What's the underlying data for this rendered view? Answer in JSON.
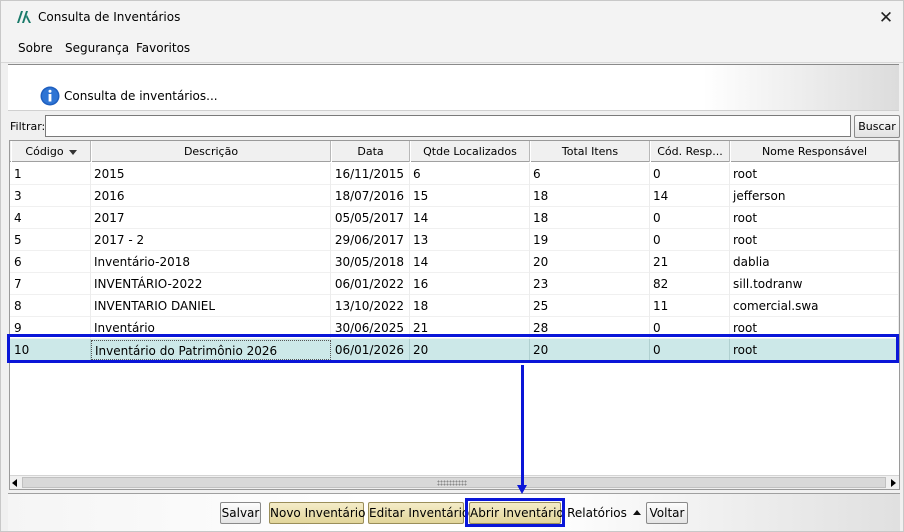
{
  "window": {
    "title": "Consulta de Inventários",
    "close_glyph": "✕"
  },
  "menu": {
    "items": [
      "Sobre",
      "Segurança",
      "Favoritos"
    ]
  },
  "banner": {
    "text": "Consulta de inventários..."
  },
  "filter": {
    "label": "Filtrar:",
    "value": "",
    "search_button": "Buscar"
  },
  "table": {
    "columns": [
      "Código",
      "Descrição",
      "Data",
      "Qtde Localizados",
      "Total Itens",
      "Cód. Resp...",
      "Nome Responsável"
    ],
    "sort_column": "Código",
    "sort_direction": "descending-arrow",
    "rows": [
      [
        "1",
        "2015",
        "16/11/2015",
        "6",
        "6",
        "0",
        "root"
      ],
      [
        "3",
        "2016",
        "18/07/2016",
        "15",
        "18",
        "14",
        "jefferson"
      ],
      [
        "4",
        "2017",
        "05/05/2017",
        "14",
        "18",
        "0",
        "root"
      ],
      [
        "5",
        "2017 - 2",
        "29/06/2017",
        "13",
        "19",
        "0",
        "root"
      ],
      [
        "6",
        "Inventário-2018",
        "30/05/2018",
        "14",
        "20",
        "21",
        "dablia"
      ],
      [
        "7",
        "INVENTÁRIO-2022",
        "06/01/2022",
        "16",
        "23",
        "82",
        "sill.todranw"
      ],
      [
        "8",
        "INVENTARIO DANIEL",
        "13/10/2022",
        "18",
        "25",
        "11",
        "comercial.swa"
      ],
      [
        "9",
        "Inventário",
        "30/06/2025",
        "21",
        "28",
        "0",
        "root"
      ],
      [
        "10",
        "Inventário do Patrimônio 2026",
        "06/01/2026",
        "20",
        "20",
        "0",
        "root"
      ]
    ],
    "selected_row_index": 8
  },
  "toolbar": {
    "salvar": "Salvar",
    "novo": "Novo Inventário",
    "editar": "Editar Inventário",
    "abrir": "Abrir Inventário",
    "relatorios": "Relatórios",
    "voltar": "Voltar"
  },
  "colors": {
    "selection": "#cce8e8",
    "highlight_annotation": "#0a16d8",
    "gold_button": "#e8dca8",
    "info_icon": "#1f5fbf"
  },
  "icons": [
    "app-logo-icon",
    "close-icon",
    "info-icon",
    "sort-down-icon",
    "scroll-left-icon",
    "scroll-right-icon",
    "caret-up-icon"
  ]
}
